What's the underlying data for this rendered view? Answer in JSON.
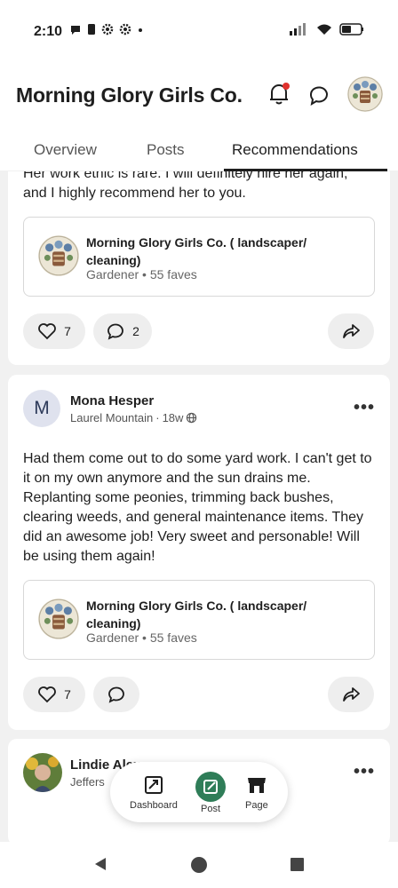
{
  "status_bar": {
    "time": "2:10"
  },
  "header": {
    "title": "Morning Glory Girls Co."
  },
  "tabs": [
    {
      "label": "Overview"
    },
    {
      "label": "Posts"
    },
    {
      "label": "Recommendations",
      "active": true
    }
  ],
  "recommendations": [
    {
      "text_partial": "Her work ethic is rare. I will definitely hire her again, and I highly recommend her to you.",
      "business": {
        "name": "Morning Glory Girls Co. ( landscaper/ cleaning)",
        "category": "Gardener",
        "faves": "55 faves"
      },
      "likes": "7",
      "comments": "2"
    },
    {
      "author": {
        "initial": "M",
        "name": "Mona Hesper",
        "location": "Laurel Mountain",
        "age": "18w"
      },
      "text": "Had them come out to do some yard work. I can't get to it on my own anymore  and the sun drains me. Replanting some peonies, trimming back bushes, clearing weeds, and general maintenance items.  They did an awesome job! Very sweet and personable! Will be using them again!",
      "business": {
        "name": "Morning Glory Girls Co. ( landscaper/ cleaning)",
        "category": "Gardener",
        "faves": "55 faves"
      },
      "likes": "7",
      "comments": ""
    },
    {
      "author": {
        "name": "Lindie Alex",
        "location": "Jeffers"
      }
    }
  ],
  "float_nav": [
    {
      "label": "Dashboard",
      "icon": "dashboard-icon"
    },
    {
      "label": "Post",
      "icon": "post-icon"
    },
    {
      "label": "Page",
      "icon": "page-icon"
    }
  ],
  "colors": {
    "accent_green": "#2f7d58",
    "notification_dot": "#e0322e"
  }
}
